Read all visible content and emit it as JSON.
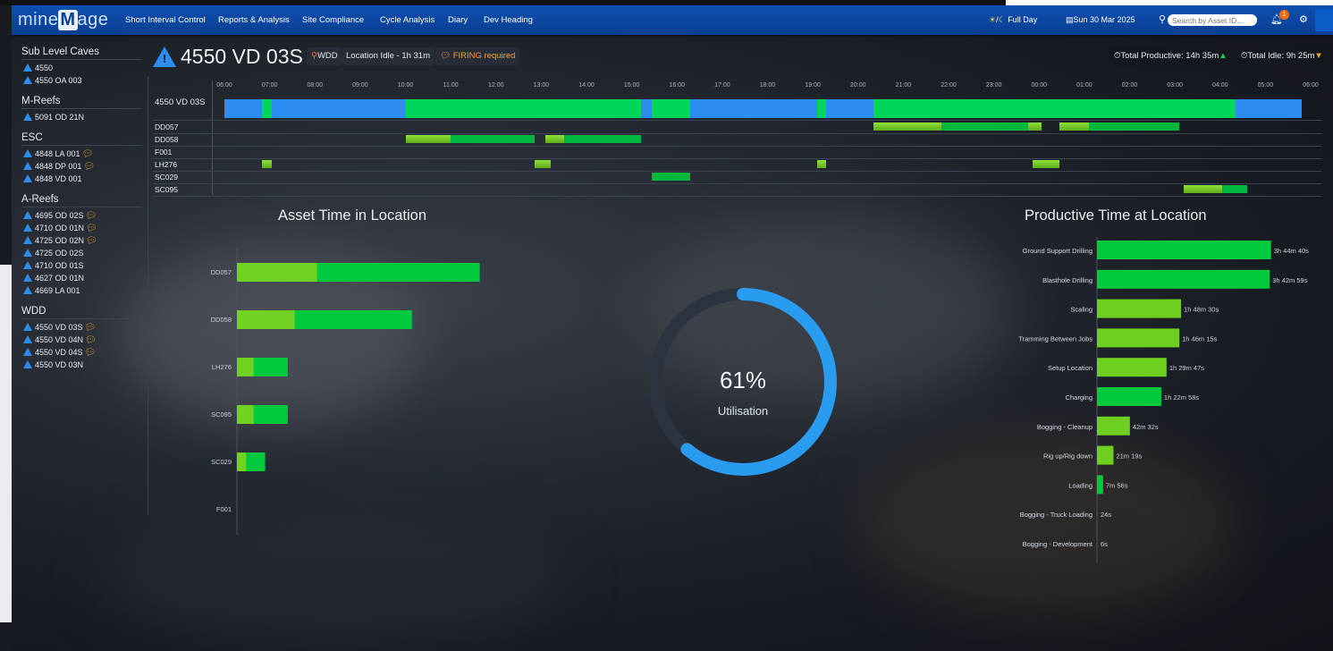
{
  "colors": {
    "blue": "#2d8cf0",
    "green": "#00d65a",
    "lime": "#7ed321",
    "darkgreen": "#00b83d",
    "navbar": "#0a3f93"
  },
  "app": {
    "logo_prefix": "mine",
    "logo_mid": "M",
    "logo_suffix": "age"
  },
  "nav": {
    "items": [
      "Short Interval Control",
      "Reports & Analysis",
      "Site Compliance",
      "Cycle Analysis",
      "Diary",
      "Dev Heading"
    ],
    "shift": "Full Day",
    "date": "Sun 30 Mar 2025",
    "search_placeholder": "Search by Asset ID...",
    "notif_count": "1"
  },
  "sidebar": {
    "groups": [
      {
        "name": "Sub Level Caves",
        "items": [
          {
            "label": "4550",
            "chat": false
          },
          {
            "label": "4550 OA 003",
            "chat": false
          }
        ]
      },
      {
        "name": "M-Reefs",
        "items": [
          {
            "label": "5091 OD 21N",
            "chat": false
          }
        ]
      },
      {
        "name": "ESC",
        "items": [
          {
            "label": "4848 LA 001",
            "chat": true
          },
          {
            "label": "4848 DP 001",
            "chat": true
          },
          {
            "label": "4848 VD 001",
            "chat": false
          }
        ]
      },
      {
        "name": "A-Reefs",
        "items": [
          {
            "label": "4695 OD 02S",
            "chat": true
          },
          {
            "label": "4710 OD 01N",
            "chat": true
          },
          {
            "label": "4725 OD 02N",
            "chat": true
          },
          {
            "label": "4725 OD 02S",
            "chat": false
          },
          {
            "label": "4710 OD 01S",
            "chat": false
          },
          {
            "label": "4627 OD 01N",
            "chat": false
          },
          {
            "label": "4669 LA 001",
            "chat": false
          }
        ]
      },
      {
        "name": "WDD",
        "items": [
          {
            "label": "4550 VD 03S",
            "chat": true
          },
          {
            "label": "4550 VD 04N",
            "chat": true
          },
          {
            "label": "4550 VD 04S",
            "chat": true
          },
          {
            "label": "4550 VD 03N",
            "chat": false
          }
        ]
      }
    ]
  },
  "header": {
    "title": "4550 VD 03S",
    "tag": "WDD",
    "idle": "Location Idle - 1h 31m",
    "firing": "FIRING required",
    "total_productive": "Total Productive: 14h 35m",
    "total_idle": "Total Idle: 9h 25m"
  },
  "timeline": {
    "ticks": [
      "06:00",
      "07:00",
      "08:00",
      "09:00",
      "10:00",
      "11:00",
      "12:00",
      "13:00",
      "14:00",
      "15:00",
      "16:00",
      "17:00",
      "18:00",
      "19:00",
      "20:00",
      "21:00",
      "22:00",
      "23:00",
      "00:00",
      "01:00",
      "02:00",
      "03:00",
      "04:00",
      "05:00",
      "06:00"
    ],
    "rows": [
      {
        "label": "4550 VD 03S",
        "segments": [
          [
            0,
            0.83,
            "blue"
          ],
          [
            0.83,
            1.05,
            "green"
          ],
          [
            1.05,
            4,
            "blue"
          ],
          [
            4,
            9.2,
            "green"
          ],
          [
            9.2,
            9.45,
            "blue"
          ],
          [
            9.45,
            10.3,
            "green"
          ],
          [
            10.3,
            13.1,
            "blue"
          ],
          [
            13.1,
            13.3,
            "green"
          ],
          [
            13.3,
            14.35,
            "blue"
          ],
          [
            14.35,
            18.4,
            "green"
          ],
          [
            18.4,
            22.35,
            "green"
          ],
          [
            22.35,
            23.8,
            "blue"
          ]
        ]
      },
      {
        "label": "DD057",
        "segments": [
          [
            14.35,
            15.85,
            "lime"
          ],
          [
            15.85,
            17.75,
            "darkgreen"
          ],
          [
            17.75,
            18.05,
            "lime"
          ],
          [
            18.45,
            19.1,
            "lime"
          ],
          [
            19.1,
            21.1,
            "darkgreen"
          ]
        ]
      },
      {
        "label": "DD058",
        "segments": [
          [
            4,
            5,
            "lime"
          ],
          [
            5,
            6.85,
            "darkgreen"
          ],
          [
            7.1,
            7.5,
            "lime"
          ],
          [
            7.5,
            9.2,
            "darkgreen"
          ]
        ]
      },
      {
        "label": "F001",
        "segments": []
      },
      {
        "label": "LH276",
        "segments": [
          [
            0.83,
            1.05,
            "lime"
          ],
          [
            6.85,
            7.2,
            "lime"
          ],
          [
            13.1,
            13.3,
            "lime"
          ],
          [
            17.85,
            18.45,
            "lime"
          ]
        ]
      },
      {
        "label": "SC029",
        "segments": [
          [
            9.45,
            10.3,
            "darkgreen"
          ]
        ]
      },
      {
        "label": "SC095",
        "segments": [
          [
            21.2,
            22.05,
            "lime"
          ],
          [
            22.05,
            22.6,
            "darkgreen"
          ]
        ]
      }
    ]
  },
  "asset_chart": {
    "title": "Asset Time in Location",
    "categories": [
      "DD057",
      "DD058",
      "LH276",
      "SC095",
      "SC029",
      "F001"
    ]
  },
  "utilisation": {
    "value": "61%",
    "label": "Utilisation",
    "pct": 61
  },
  "productive_chart": {
    "title": "Productive Time at Location",
    "items": [
      {
        "label": "Ground Support Drilling",
        "value": "3h 44m 40s",
        "minutes": 224.7
      },
      {
        "label": "Blasthole Drilling",
        "value": "3h 42m 59s",
        "minutes": 223.0
      },
      {
        "label": "Scaling",
        "value": "1h 48m 30s",
        "minutes": 108.5
      },
      {
        "label": "Tramming Between Jobs",
        "value": "1h 46m 15s",
        "minutes": 106.3
      },
      {
        "label": "Setup Location",
        "value": "1h 29m 47s",
        "minutes": 89.8
      },
      {
        "label": "Charging",
        "value": "1h 22m 58s",
        "minutes": 83.0
      },
      {
        "label": "Bogging - Cleanup",
        "value": "42m 32s",
        "minutes": 42.5
      },
      {
        "label": "Rig up/Rig down",
        "value": "21m 19s",
        "minutes": 21.3
      },
      {
        "label": "Loading",
        "value": "7m 56s",
        "minutes": 7.9
      },
      {
        "label": "Bogging - Truck Loading",
        "value": "24s",
        "minutes": 0.4
      },
      {
        "label": "Bogging - Development",
        "value": "6s",
        "minutes": 0.1
      }
    ]
  },
  "chart_data": [
    {
      "type": "bar",
      "title": "Asset Time in Location",
      "categories": [
        "DD057",
        "DD058",
        "LH276",
        "SC095",
        "SC029",
        "F001"
      ],
      "series": [
        {
          "values": [
            8.6,
            6.2,
            1.8,
            1.8,
            1.0,
            0
          ]
        }
      ]
    },
    {
      "type": "bar",
      "title": "Productive Time at Location",
      "categories": [
        "Ground Support Drilling",
        "Blasthole Drilling",
        "Scaling",
        "Tramming Between Jobs",
        "Setup Location",
        "Charging",
        "Bogging - Cleanup",
        "Rig up/Rig down",
        "Loading",
        "Bogging - Truck Loading",
        "Bogging - Development"
      ],
      "series": [
        {
          "values": [
            224.7,
            223.0,
            108.5,
            106.3,
            89.8,
            83.0,
            42.5,
            21.3,
            7.9,
            0.4,
            0.1
          ]
        }
      ]
    }
  ]
}
